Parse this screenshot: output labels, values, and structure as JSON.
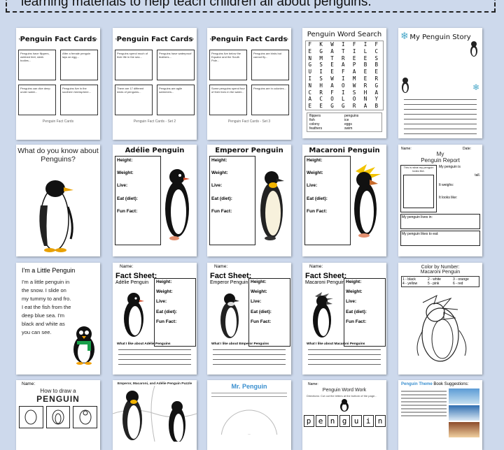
{
  "banner": {
    "text": "learning materials to help teach children all about penguins."
  },
  "thumbs": {
    "fact_cards_1": {
      "title": "Penguin Fact Cards",
      "footer": "Penguin Fact Cards"
    },
    "fact_cards_2": {
      "title": "Penguin Fact Cards",
      "footer": "Penguin Fact Cards - Set 2"
    },
    "fact_cards_3": {
      "title": "Penguin Fact Cards",
      "footer": "Penguin Fact Cards - Set 3"
    },
    "word_search": {
      "title": "Penguin Word Search",
      "rows": [
        "F K W I F I F",
        "E G A T I L C",
        "N M T R E E S",
        "G S E A P B B",
        "U I E F A E E",
        "I S W I M E R",
        "N H A O W R G",
        "C R F I S H A",
        "A C O L O N Y",
        "E E G G R A B"
      ],
      "words": [
        "flippers",
        "penguins",
        "fish",
        "ice",
        "colony",
        "eggs",
        "feathers",
        "swim"
      ]
    },
    "story": {
      "title": "My Penguin Story"
    },
    "what_know": {
      "title": "What do you know about Penguins?"
    },
    "adelie": {
      "title": "Adélie Penguin",
      "labels": [
        "Height:",
        "Weight:",
        "Live:",
        "Eat (diet):",
        "Fun Fact:"
      ]
    },
    "emperor": {
      "title": "Emperor Penguin",
      "labels": [
        "Height:",
        "Weight:",
        "Live:",
        "Eat (diet):",
        "Fun Fact:"
      ]
    },
    "macaroni": {
      "title": "Macaroni Penguin",
      "labels": [
        "Height:",
        "Weight:",
        "Live:",
        "Eat (diet):",
        "Fun Fact:"
      ]
    },
    "report": {
      "name": "Name:",
      "date": "Date:",
      "title_1": "My",
      "title_2": "Penguin Report",
      "looks_like": "This is what my penguin looks like.",
      "is": "My penguin is",
      "tall": "tall.",
      "weighs": "It weighs:",
      "looks": "It looks like:",
      "lives": "My penguin lives in:",
      "eat": "My penguin likes to eat:"
    },
    "little": {
      "title": "I'm a Little Penguin",
      "poem": "I'm a little penguin in the snow. I slide on my tummy to and fro. I eat the fish from the deep blue sea. I'm black and white as you can see."
    },
    "fs_adelie": {
      "name": "Name:",
      "title_1": "Fact Sheet:",
      "title_2": "Adélie Penguin",
      "like": "What I like about Adélie Penguins"
    },
    "fs_emperor": {
      "name": "Name:",
      "title_1": "Fact Sheet:",
      "title_2": "Emperor Penguin",
      "like": "What I like about Emperor Penguins"
    },
    "fs_macaroni": {
      "name": "Name:",
      "title_1": "Fact Sheet:",
      "title_2": "Macaroni Penguin",
      "like": "What I like about Macaroni Penguins"
    },
    "color": {
      "title_1": "Color by Number:",
      "title_2": "Macaroni Penguin",
      "key": [
        "1 - black",
        "2 - white",
        "3 - orange",
        "4 - yellow",
        "5 - pink",
        "6 - red"
      ]
    },
    "draw": {
      "name": "Name:",
      "title_1": "How to draw a",
      "title_2": "PENGUIN"
    },
    "puzzle": {
      "title": "Emperor, Macaroni, and Adélie Penguin Puzzle"
    },
    "mr_penguin": {
      "title": "Mr. Penguin"
    },
    "word_work": {
      "name": "Name:",
      "title": "Penguin Word Work",
      "word": "penguin"
    },
    "books": {
      "title_1": "Penguin Theme",
      "title_2": "Book Suggestions:"
    }
  },
  "colors": {
    "background": "#cdd9ec",
    "macaroni_crest": "#f2c300",
    "beak": "#e8a000",
    "scarf": "#19a04a"
  }
}
